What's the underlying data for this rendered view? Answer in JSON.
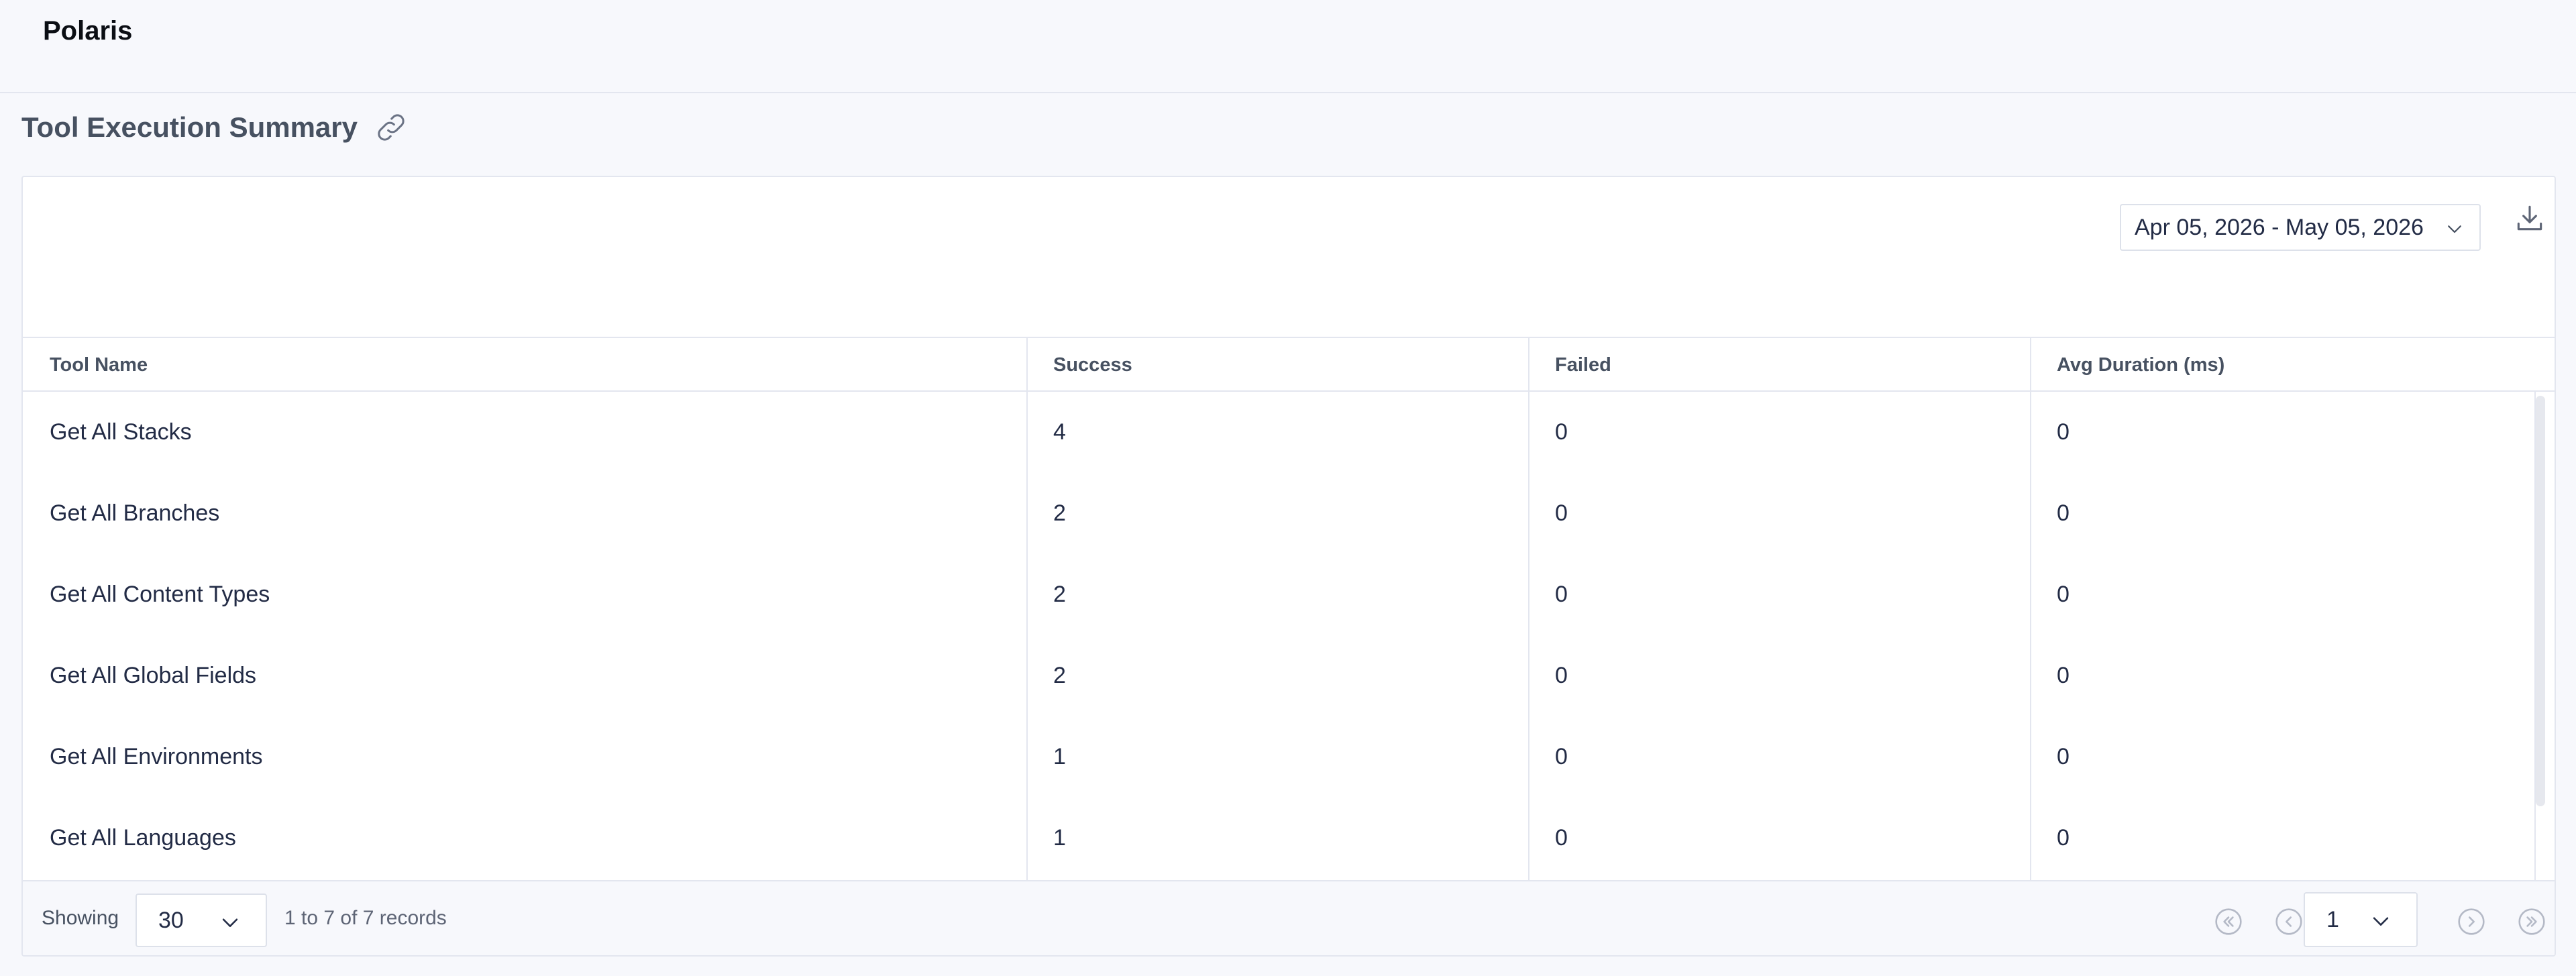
{
  "app": {
    "title": "Polaris"
  },
  "section": {
    "title": "Tool Execution Summary",
    "link_icon": "link-icon"
  },
  "toolbar": {
    "date_range": "Apr 05, 2026 - May 05, 2026",
    "download_icon": "download-icon"
  },
  "table": {
    "columns": [
      "Tool Name",
      "Success",
      "Failed",
      "Avg Duration (ms)"
    ],
    "rows": [
      [
        "Get All Stacks",
        "4",
        "0",
        "0"
      ],
      [
        "Get All Branches",
        "2",
        "0",
        "0"
      ],
      [
        "Get All Content Types",
        "2",
        "0",
        "0"
      ],
      [
        "Get All Global Fields",
        "2",
        "0",
        "0"
      ],
      [
        "Get All Environments",
        "1",
        "0",
        "0"
      ],
      [
        "Get All Languages",
        "1",
        "0",
        "0"
      ]
    ]
  },
  "footer": {
    "showing_label": "Showing",
    "page_size": "30",
    "records_text": "1 to 7 of 7 records",
    "current_page": "1"
  },
  "colors": {
    "border": "#e3e6ef",
    "text": "#222b45",
    "muted": "#475161",
    "icon": "#a9afbc"
  }
}
